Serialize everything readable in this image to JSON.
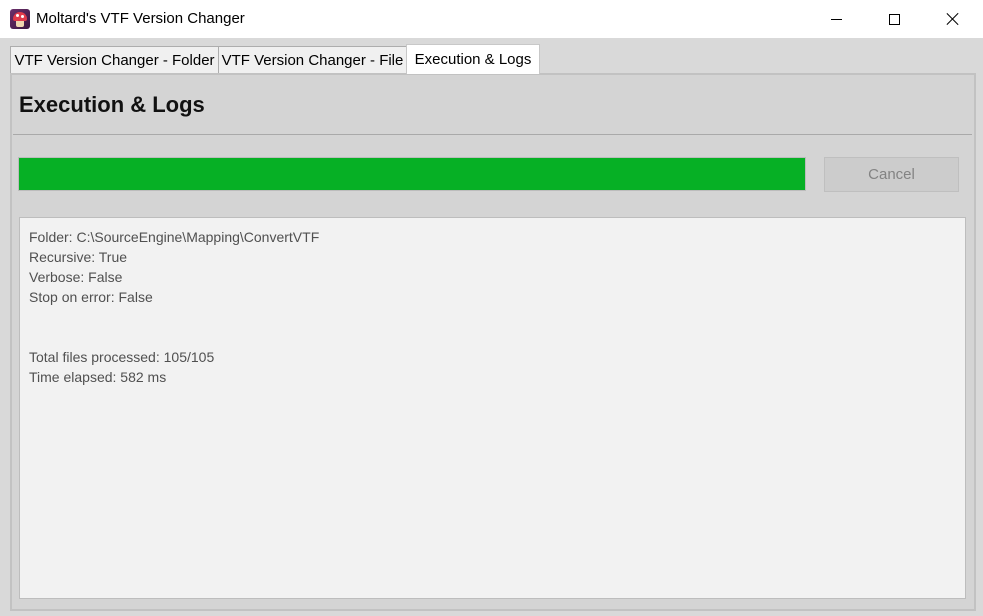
{
  "window": {
    "title": "Moltard's VTF Version Changer",
    "icon": "mushroom-app-icon"
  },
  "tabs": [
    {
      "label": "VTF Version Changer - Folder",
      "active": false
    },
    {
      "label": "VTF Version Changer - File",
      "active": false
    },
    {
      "label": "Execution & Logs",
      "active": true
    }
  ],
  "main": {
    "heading": "Execution & Logs",
    "progress": {
      "percent": 100,
      "color": "#06b025"
    },
    "cancel_label": "Cancel",
    "log_lines": [
      "Folder: C:\\SourceEngine\\Mapping\\ConvertVTF",
      "Recursive: True",
      "Verbose: False",
      "Stop on error: False",
      "",
      "",
      "Total files processed: 105/105",
      "Time elapsed: 582 ms"
    ]
  }
}
